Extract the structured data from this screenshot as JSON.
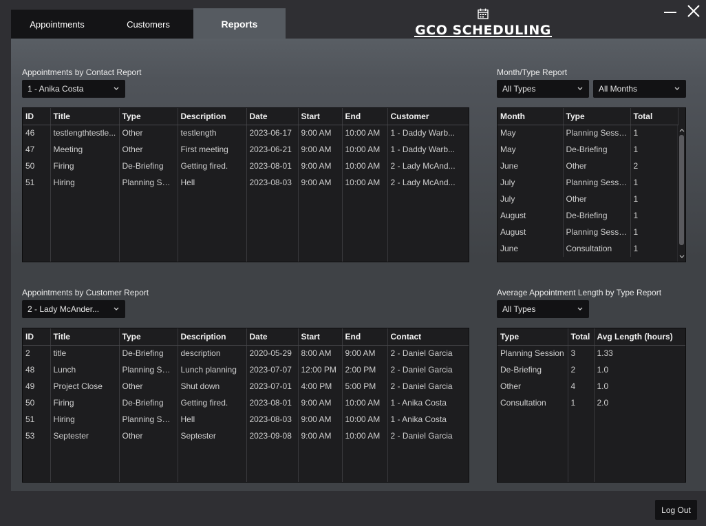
{
  "tabs": [
    {
      "label": "Appointments"
    },
    {
      "label": "Customers"
    },
    {
      "label": "Reports"
    }
  ],
  "logo": {
    "text": "GCO SCHEDULING"
  },
  "contact_report": {
    "title": "Appointments by Contact Report",
    "selected": "1 - Anika Costa",
    "columns": [
      "ID",
      "Title",
      "Type",
      "Description",
      "Date",
      "Start",
      "End",
      "Customer"
    ],
    "rows": [
      [
        "46",
        "testlengthtestle...",
        "Other",
        "testlength",
        "2023-06-17",
        "9:00 AM",
        "10:00 AM",
        "1 - Daddy Warb..."
      ],
      [
        "47",
        "Meeting",
        "Other",
        "First meeting",
        "2023-06-21",
        "9:00 AM",
        "10:00 AM",
        "1 - Daddy Warb..."
      ],
      [
        "50",
        "Firing",
        "De-Briefing",
        "Getting fired.",
        "2023-08-01",
        "9:00 AM",
        "10:00 AM",
        "2 - Lady McAnd..."
      ],
      [
        "51",
        "Hiring",
        "Planning Ses...",
        "Hell",
        "2023-08-03",
        "9:00 AM",
        "10:00 AM",
        "2 - Lady McAnd..."
      ]
    ]
  },
  "month_type_report": {
    "title": "Month/Type Report",
    "type_filter": "All Types",
    "month_filter": "All Months",
    "columns": [
      "Month",
      "Type",
      "Total"
    ],
    "rows": [
      [
        "May",
        "Planning Session",
        "1"
      ],
      [
        "May",
        "De-Briefing",
        "1"
      ],
      [
        "June",
        "Other",
        "2"
      ],
      [
        "July",
        "Planning Session",
        "1"
      ],
      [
        "July",
        "Other",
        "1"
      ],
      [
        "August",
        "De-Briefing",
        "1"
      ],
      [
        "August",
        "Planning Session",
        "1"
      ],
      [
        "June",
        "Consultation",
        "1"
      ]
    ]
  },
  "customer_report": {
    "title": "Appointments by Customer Report",
    "selected": "2 - Lady McAnder...",
    "columns": [
      "ID",
      "Title",
      "Type",
      "Description",
      "Date",
      "Start",
      "End",
      "Contact"
    ],
    "rows": [
      [
        "2",
        "title",
        "De-Briefing",
        "description",
        "2020-05-29",
        "8:00 AM",
        "9:00 AM",
        "2 - Daniel Garcia"
      ],
      [
        "48",
        "Lunch",
        "Planning Ses...",
        "Lunch planning",
        "2023-07-07",
        "12:00 PM",
        "2:00 PM",
        "2 - Daniel Garcia"
      ],
      [
        "49",
        "Project Close",
        "Other",
        "Shut down",
        "2023-07-01",
        "4:00 PM",
        "5:00 PM",
        "2 - Daniel Garcia"
      ],
      [
        "50",
        "Firing",
        "De-Briefing",
        "Getting fired.",
        "2023-08-01",
        "9:00 AM",
        "10:00 AM",
        "1 - Anika Costa"
      ],
      [
        "51",
        "Hiring",
        "Planning Ses...",
        "Hell",
        "2023-08-03",
        "9:00 AM",
        "10:00 AM",
        "1 - Anika Costa"
      ],
      [
        "53",
        "Septester",
        "Other",
        "Septester",
        "2023-09-08",
        "9:00 AM",
        "10:00 AM",
        "2 - Daniel Garcia"
      ]
    ]
  },
  "avg_length_report": {
    "title": "Average Appointment Length by Type Report",
    "type_filter": "All Types",
    "columns": [
      "Type",
      "Total",
      "Avg Length (hours)"
    ],
    "rows": [
      [
        "Planning Session",
        "3",
        "1.33"
      ],
      [
        "De-Briefing",
        "2",
        "1.0"
      ],
      [
        "Other",
        "4",
        "1.0"
      ],
      [
        "Consultation",
        "1",
        "2.0"
      ]
    ]
  },
  "logout_label": "Log Out",
  "colors": {
    "accent_tab": "#565b61",
    "dark": "#121214",
    "table_bg": "#1d1d1f"
  }
}
